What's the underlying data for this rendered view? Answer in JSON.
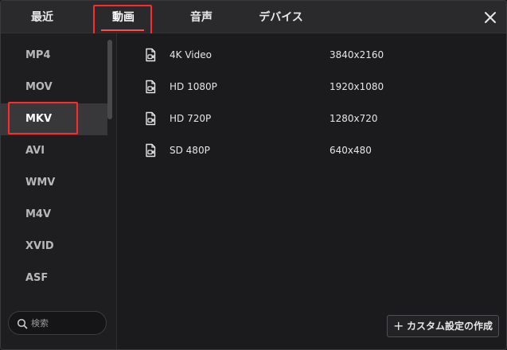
{
  "tabs": [
    {
      "label": "最近"
    },
    {
      "label": "動画"
    },
    {
      "label": "音声"
    },
    {
      "label": "デバイス"
    }
  ],
  "active_tab": "動画",
  "formats": [
    {
      "label": "MP4"
    },
    {
      "label": "MOV"
    },
    {
      "label": "MKV"
    },
    {
      "label": "AVI"
    },
    {
      "label": "WMV"
    },
    {
      "label": "M4V"
    },
    {
      "label": "XVID"
    },
    {
      "label": "ASF"
    }
  ],
  "active_format": "MKV",
  "search": {
    "placeholder": "検索",
    "icon": "search-icon"
  },
  "presets": [
    {
      "name": "4K Video",
      "resolution": "3840x2160",
      "icon": "video-file-icon"
    },
    {
      "name": "HD 1080P",
      "resolution": "1920x1080",
      "icon": "video-file-icon"
    },
    {
      "name": "HD 720P",
      "resolution": "1280x720",
      "icon": "video-file-icon"
    },
    {
      "name": "SD 480P",
      "resolution": "640x480",
      "icon": "video-file-icon"
    }
  ],
  "custom_button": {
    "label": "カスタム設定の作成",
    "icon": "plus-icon"
  },
  "colors": {
    "accent_red": "#ff2b2b",
    "background": "#1b1b1d",
    "tabbar": "#2a2a2c",
    "active_item": "#38383b"
  }
}
